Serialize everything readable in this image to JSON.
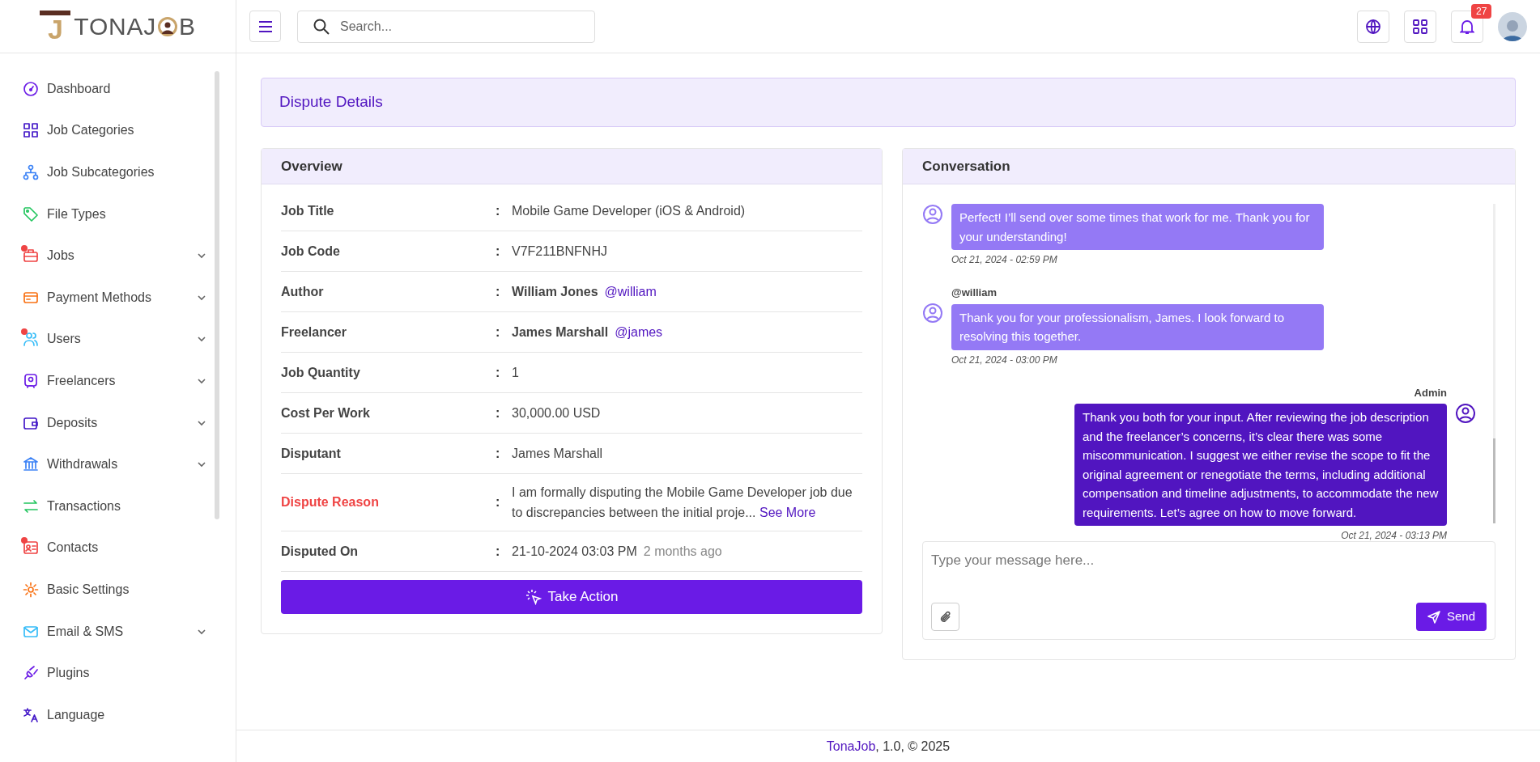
{
  "brand": {
    "mark": "J",
    "name": "TONAJ",
    "name_tail": "B"
  },
  "header": {
    "search": {
      "placeholder": "Search..."
    },
    "notifications": "27"
  },
  "sidebar": {
    "items": [
      {
        "label": "Dashboard",
        "alert": false,
        "expandable": false
      },
      {
        "label": "Job Categories",
        "alert": false,
        "expandable": false
      },
      {
        "label": "Job Subcategories",
        "alert": false,
        "expandable": false
      },
      {
        "label": "File Types",
        "alert": false,
        "expandable": false
      },
      {
        "label": "Jobs",
        "alert": true,
        "expandable": true
      },
      {
        "label": "Payment Methods",
        "alert": false,
        "expandable": true
      },
      {
        "label": "Users",
        "alert": true,
        "expandable": true
      },
      {
        "label": "Freelancers",
        "alert": false,
        "expandable": true
      },
      {
        "label": "Deposits",
        "alert": false,
        "expandable": true
      },
      {
        "label": "Withdrawals",
        "alert": false,
        "expandable": true
      },
      {
        "label": "Transactions",
        "alert": false,
        "expandable": false
      },
      {
        "label": "Contacts",
        "alert": true,
        "expandable": false
      },
      {
        "label": "Basic Settings",
        "alert": false,
        "expandable": false
      },
      {
        "label": "Email & SMS",
        "alert": false,
        "expandable": true
      },
      {
        "label": "Plugins",
        "alert": false,
        "expandable": false
      },
      {
        "label": "Language",
        "alert": false,
        "expandable": false
      }
    ]
  },
  "page_title": "Dispute Details",
  "overview": {
    "title": "Overview",
    "rows": [
      {
        "kind": "text",
        "label": "Job Title",
        "highlight": false,
        "separator": ":",
        "value": "Mobile Game Developer (iOS & Android)"
      },
      {
        "kind": "text",
        "label": "Job Code",
        "highlight": false,
        "separator": ":",
        "value": "V7F211BNFNHJ"
      },
      {
        "kind": "user",
        "label": "Author",
        "highlight": false,
        "separator": ":",
        "value": "William Jones",
        "handle": "@william"
      },
      {
        "kind": "user",
        "label": "Freelancer",
        "highlight": false,
        "separator": ":",
        "value": "James Marshall",
        "handle": "@james"
      },
      {
        "kind": "text",
        "label": "Job Quantity",
        "highlight": false,
        "separator": ":",
        "value": "1"
      },
      {
        "kind": "text",
        "label": "Cost Per Work",
        "highlight": false,
        "separator": ":",
        "value": "30,000.00 USD"
      },
      {
        "kind": "text",
        "label": "Disputant",
        "highlight": false,
        "separator": ":",
        "value": "James Marshall"
      },
      {
        "kind": "reason",
        "label": "Dispute Reason",
        "highlight": true,
        "separator": ":",
        "value": "I am formally disputing the Mobile Game Developer job due to discrepancies between the initial proje...",
        "link": "See More"
      },
      {
        "kind": "date",
        "label": "Disputed On",
        "highlight": false,
        "separator": ":",
        "value": "21-10-2024 03:03 PM",
        "note": "2 months ago"
      }
    ],
    "action": "Take Action"
  },
  "conversation": {
    "title": "Conversation",
    "messages": [
      {
        "kind": "received",
        "text": "Perfect! I’ll send over some times that work for me. Thank you for your understanding!",
        "time": "Oct 21, 2024 - 02:59 PM"
      },
      {
        "kind": "received",
        "author": "@william",
        "text": "Thank you for your professionalism, James. I look forward to resolving this together.",
        "time": "Oct 21, 2024 - 03:00 PM"
      },
      {
        "kind": "sent",
        "author": "Admin",
        "text": "Thank you both for your input. After reviewing the job description and the freelancer’s concerns, it’s clear there was some miscommunication. I suggest we either revise the scope to fit the original agreement or renegotiate the terms, including additional compensation and timeline adjustments, to accommodate the new requirements. Let’s agree on how to move forward.",
        "time": "Oct 21, 2024 - 03:13 PM"
      }
    ],
    "composer": {
      "placeholder": "Type your message here...",
      "send": "Send"
    }
  },
  "footer": {
    "brand": "TonaJob",
    "text": ", 1.0, © 2025"
  }
}
